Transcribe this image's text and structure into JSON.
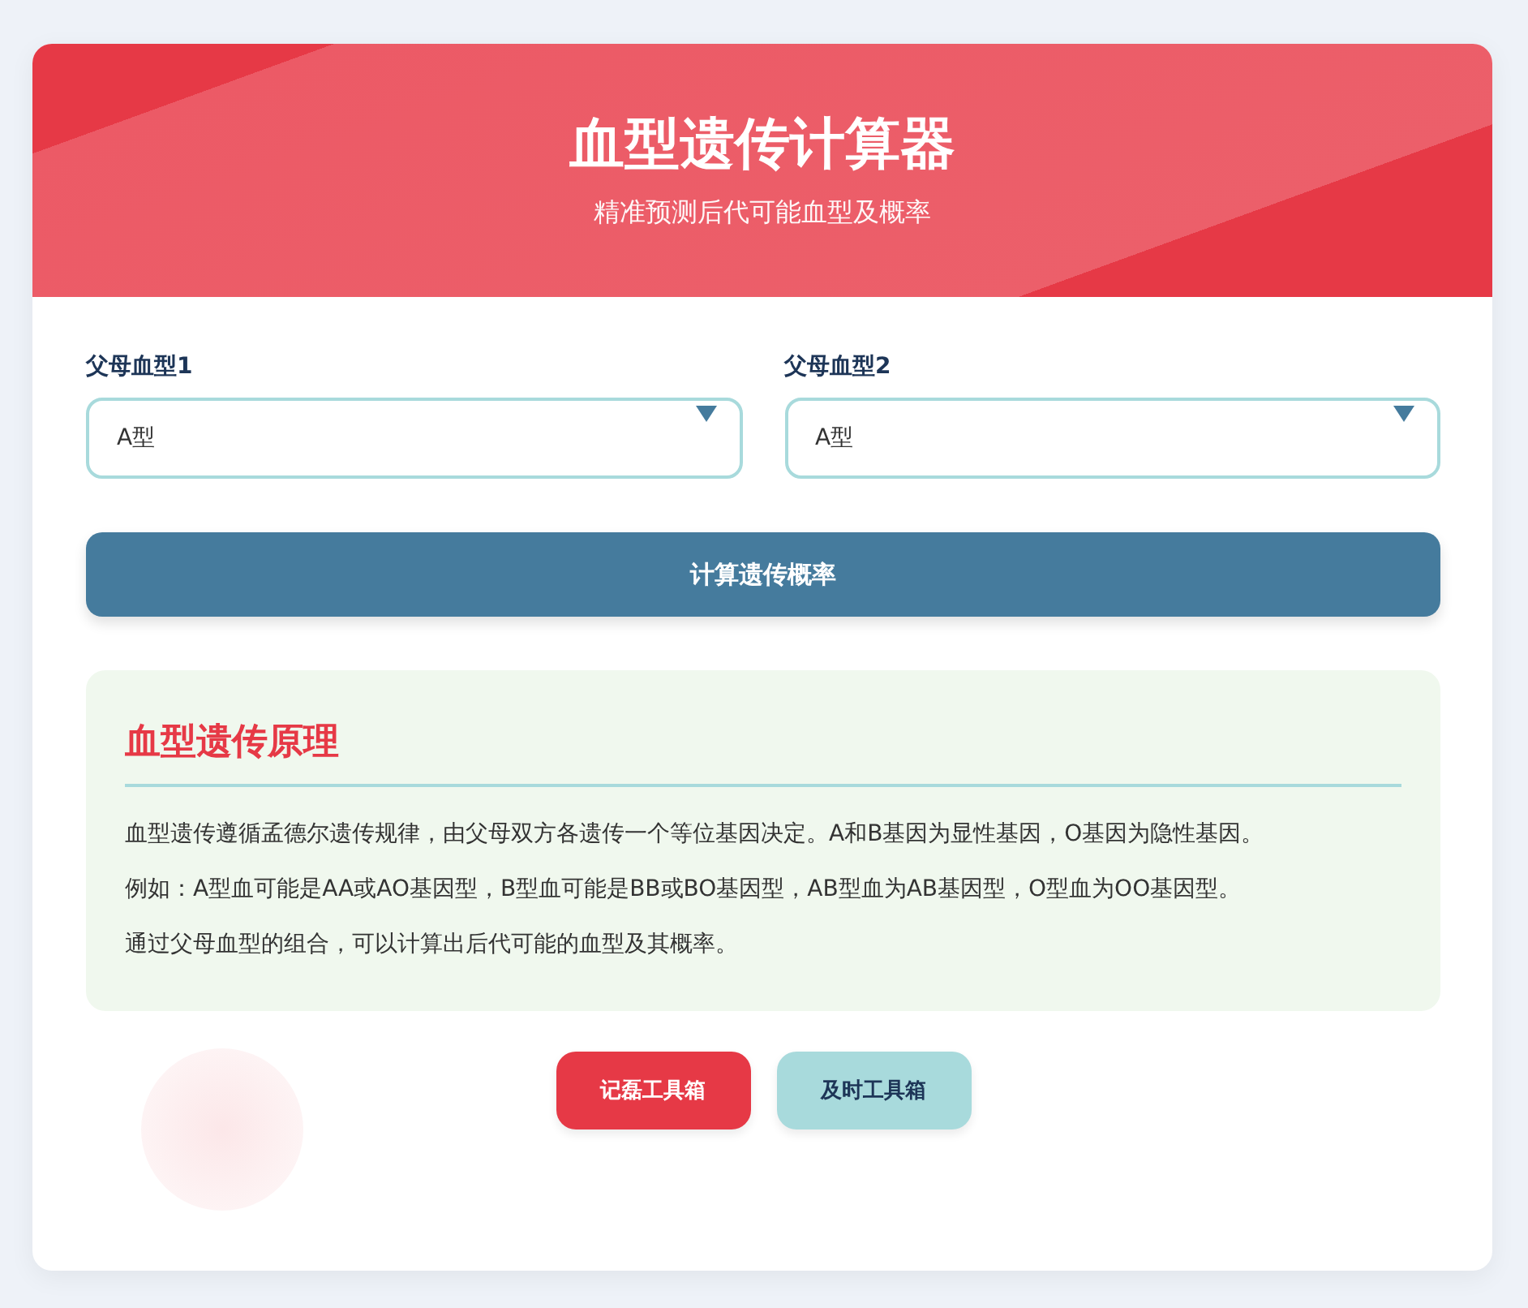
{
  "header": {
    "title": "血型遗传计算器",
    "subtitle": "精准预测后代可能血型及概率"
  },
  "selects": [
    {
      "label": "父母血型1",
      "value": "A型"
    },
    {
      "label": "父母血型2",
      "value": "A型"
    }
  ],
  "calculate_button": "计算遗传概率",
  "info": {
    "title": "血型遗传原理",
    "paragraphs": [
      "血型遗传遵循孟德尔遗传规律，由父母双方各遗传一个等位基因决定。A和B基因为显性基因，O基因为隐性基因。",
      "例如：A型血可能是AA或AO基因型，B型血可能是BB或BO基因型，AB型血为AB基因型，O型血为OO基因型。",
      "通过父母血型的组合，可以计算出后代可能的血型及其概率。"
    ]
  },
  "footer_buttons": [
    {
      "label": "记磊工具箱",
      "kind": "primary"
    },
    {
      "label": "及时工具箱",
      "kind": "secondary"
    }
  ]
}
